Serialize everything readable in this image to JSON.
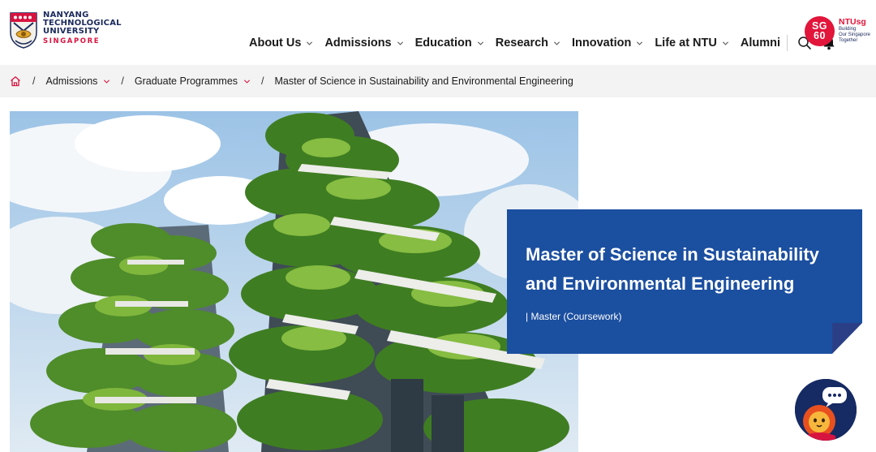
{
  "header": {
    "logo_lines": [
      "NANYANG",
      "TECHNOLOGICAL",
      "UNIVERSITY",
      "SINGAPORE"
    ],
    "nav": [
      {
        "label": "About Us",
        "has_dropdown": true
      },
      {
        "label": "Admissions",
        "has_dropdown": true
      },
      {
        "label": "Education",
        "has_dropdown": true
      },
      {
        "label": "Research",
        "has_dropdown": true
      },
      {
        "label": "Innovation",
        "has_dropdown": true
      },
      {
        "label": "Life at NTU",
        "has_dropdown": true
      },
      {
        "label": "Alumni",
        "has_dropdown": false
      }
    ],
    "icons": [
      "search-icon",
      "bell-icon"
    ],
    "sg60": {
      "line1": "SG",
      "line2": "60"
    },
    "ntusg": {
      "title": "NTUsg",
      "tagline": [
        "Building",
        "Our Singapore",
        "Together"
      ]
    }
  },
  "breadcrumb": {
    "home_icon": "home-icon",
    "items": [
      {
        "label": "Admissions",
        "has_dropdown": true
      },
      {
        "label": "Graduate Programmes",
        "has_dropdown": true
      }
    ],
    "current": "Master of Science in Sustainability and Environmental Engineering"
  },
  "hero": {
    "title": "Master of Science in Sustainability and Environmental Engineering",
    "subtitle": "| Master (Coursework)",
    "card_color": "#1b4fa0"
  },
  "chatbot": {
    "icon": "chatbot-icon",
    "bubble": "..."
  },
  "colors": {
    "brand_red": "#e2153a",
    "brand_navy": "#1b2a5e",
    "hero_blue": "#1b4fa0"
  }
}
